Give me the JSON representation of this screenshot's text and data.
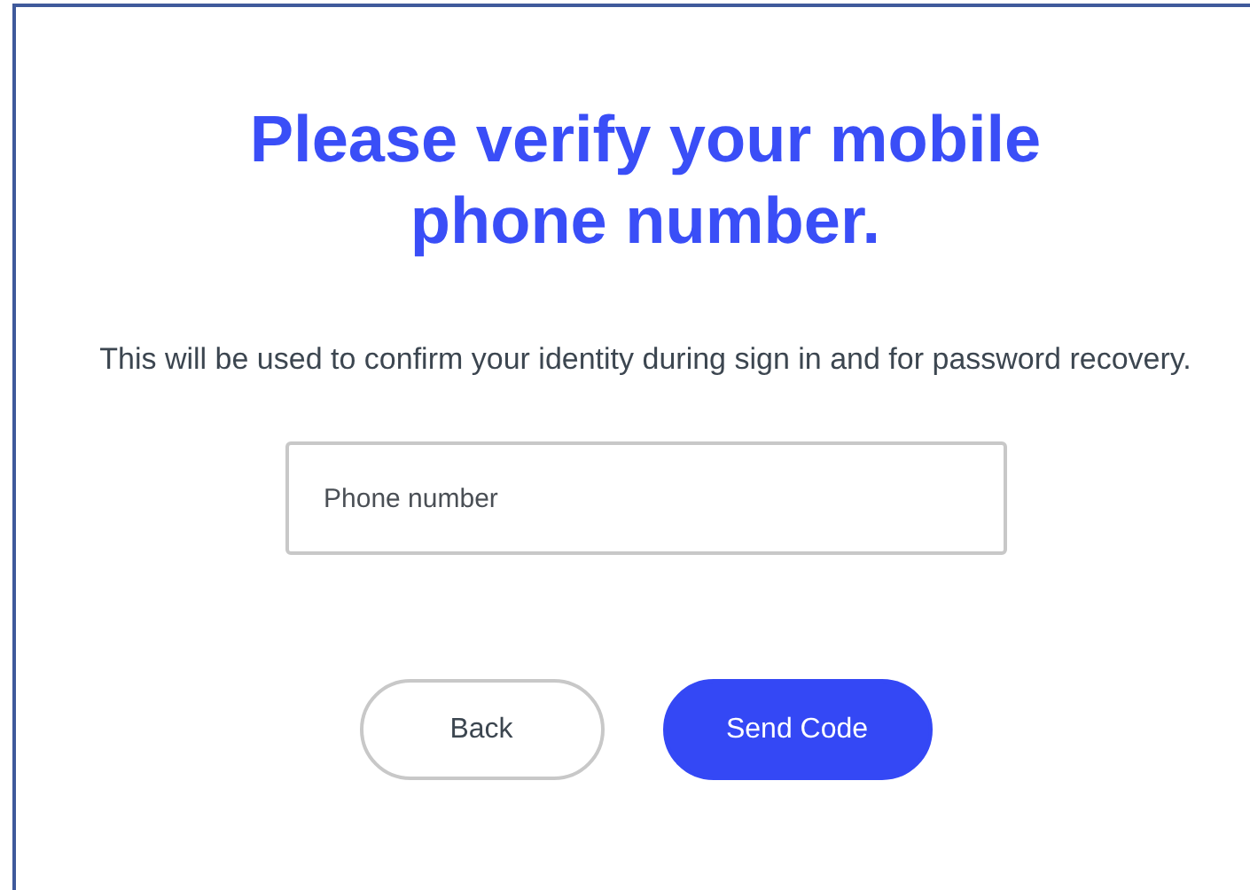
{
  "heading": "Please verify your mobile phone number.",
  "description": "This will be used to confirm your identity during sign in and for password recovery.",
  "phone_field": {
    "placeholder": "Phone number"
  },
  "buttons": [
    {
      "label": "Back",
      "kind": "secondary"
    },
    {
      "label": "Send Code",
      "kind": "primary"
    }
  ]
}
